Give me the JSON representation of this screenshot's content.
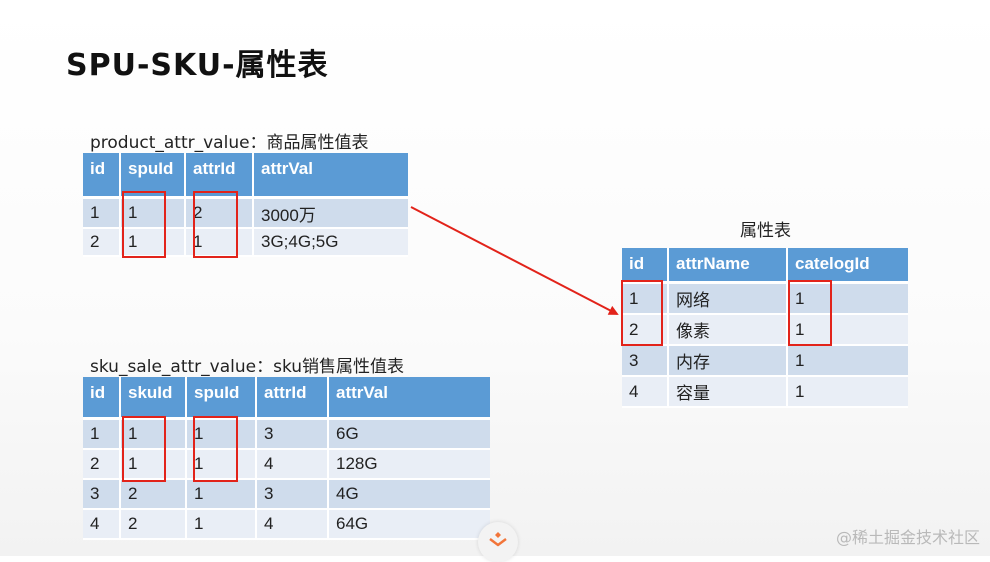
{
  "title": "SPU-SKU-属性表",
  "tables": {
    "product_attr_value": {
      "caption": "product_attr_value：商品属性值表",
      "columns": [
        "id",
        "spuId",
        "attrId",
        "attrVal"
      ],
      "rows": [
        [
          "1",
          "1",
          "2",
          "3000万"
        ],
        [
          "2",
          "1",
          "1",
          "3G;4G;5G"
        ]
      ]
    },
    "attr": {
      "caption": "属性表",
      "columns": [
        "id",
        "attrName",
        "catelogId"
      ],
      "rows": [
        [
          "1",
          "网络",
          "1"
        ],
        [
          "2",
          "像素",
          "1"
        ],
        [
          "3",
          "内存",
          "1"
        ],
        [
          "4",
          "容量",
          "1"
        ]
      ]
    },
    "sku_sale_attr_value": {
      "caption": "sku_sale_attr_value：sku销售属性值表",
      "columns": [
        "id",
        "skuId",
        "spuId",
        "attrId",
        "attrVal"
      ],
      "rows": [
        [
          "1",
          "1",
          "1",
          "3",
          "6G"
        ],
        [
          "2",
          "1",
          "1",
          "4",
          "128G"
        ],
        [
          "3",
          "2",
          "1",
          "3",
          "4G"
        ],
        [
          "4",
          "2",
          "1",
          "4",
          "64G"
        ]
      ]
    }
  },
  "colors": {
    "header": "#5b9bd5",
    "row_odd": "#cfdcec",
    "row_even": "#e9eef6",
    "highlight": "#e2231a"
  },
  "watermark": "@稀土掘金技术社区",
  "icons": {
    "logo": "juejin-logo-icon",
    "arrow": "red-arrow"
  }
}
